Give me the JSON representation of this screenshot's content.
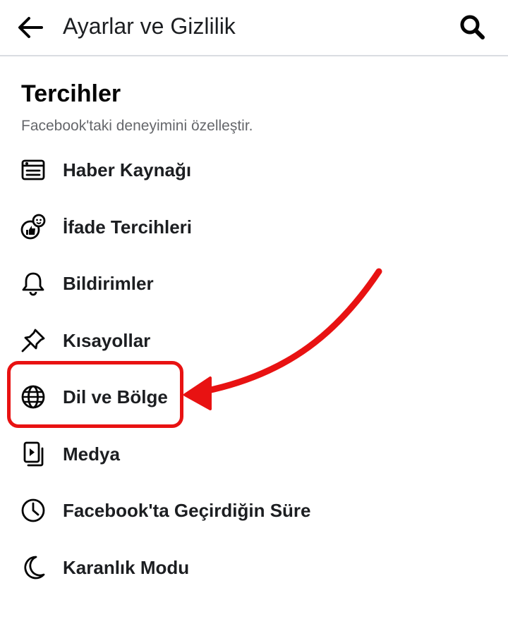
{
  "header": {
    "title": "Ayarlar ve Gizlilik",
    "back_icon": "arrow-left-icon",
    "search_icon": "search-icon"
  },
  "section": {
    "title": "Tercihler",
    "subtitle": "Facebook'taki deneyimini özelleştir."
  },
  "menu": {
    "items": [
      {
        "label": "Haber Kaynağı",
        "icon": "news-feed-icon"
      },
      {
        "label": "İfade Tercihleri",
        "icon": "reactions-icon"
      },
      {
        "label": "Bildirimler",
        "icon": "bell-icon"
      },
      {
        "label": "Kısayollar",
        "icon": "pin-icon"
      },
      {
        "label": "Dil ve Bölge",
        "icon": "globe-icon",
        "highlighted": true
      },
      {
        "label": "Medya",
        "icon": "media-icon"
      },
      {
        "label": "Facebook'ta Geçirdiğin Süre",
        "icon": "clock-icon"
      },
      {
        "label": "Karanlık Modu",
        "icon": "moon-icon"
      }
    ]
  },
  "annotation": {
    "color": "#e81212"
  }
}
